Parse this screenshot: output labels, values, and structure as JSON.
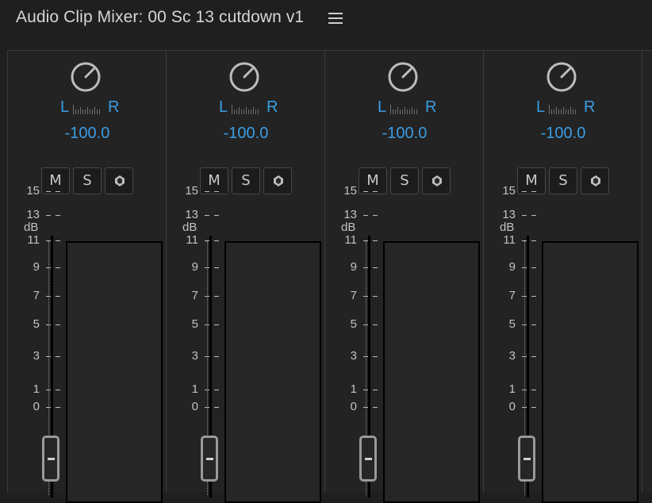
{
  "panel": {
    "title": "Audio Clip Mixer: 00 Sc 13 cutdown v1",
    "menu_icon": "hamburger-menu-icon"
  },
  "channels": [
    {
      "pan_left": "L",
      "pan_right": "R",
      "pan_value": "-100.0",
      "mute_label": "M",
      "solo_label": "S",
      "write_icon": "keyframe-diamond-icon"
    },
    {
      "pan_left": "L",
      "pan_right": "R",
      "pan_value": "-100.0",
      "mute_label": "M",
      "solo_label": "S",
      "write_icon": "keyframe-diamond-icon"
    },
    {
      "pan_left": "L",
      "pan_right": "R",
      "pan_value": "-100.0",
      "mute_label": "M",
      "solo_label": "S",
      "write_icon": "keyframe-diamond-icon"
    },
    {
      "pan_left": "L",
      "pan_right": "R",
      "pan_value": "-100.0",
      "mute_label": "M",
      "solo_label": "S",
      "write_icon": "keyframe-diamond-icon"
    }
  ],
  "scale": {
    "unit": "dB",
    "ticks": [
      "15",
      "13",
      "11",
      "9",
      "7",
      "5",
      "3",
      "1",
      "0"
    ]
  },
  "colors": {
    "accent": "#3a9ee4",
    "background": "#1f1f1f",
    "panel_text": "#d6d6d6"
  }
}
